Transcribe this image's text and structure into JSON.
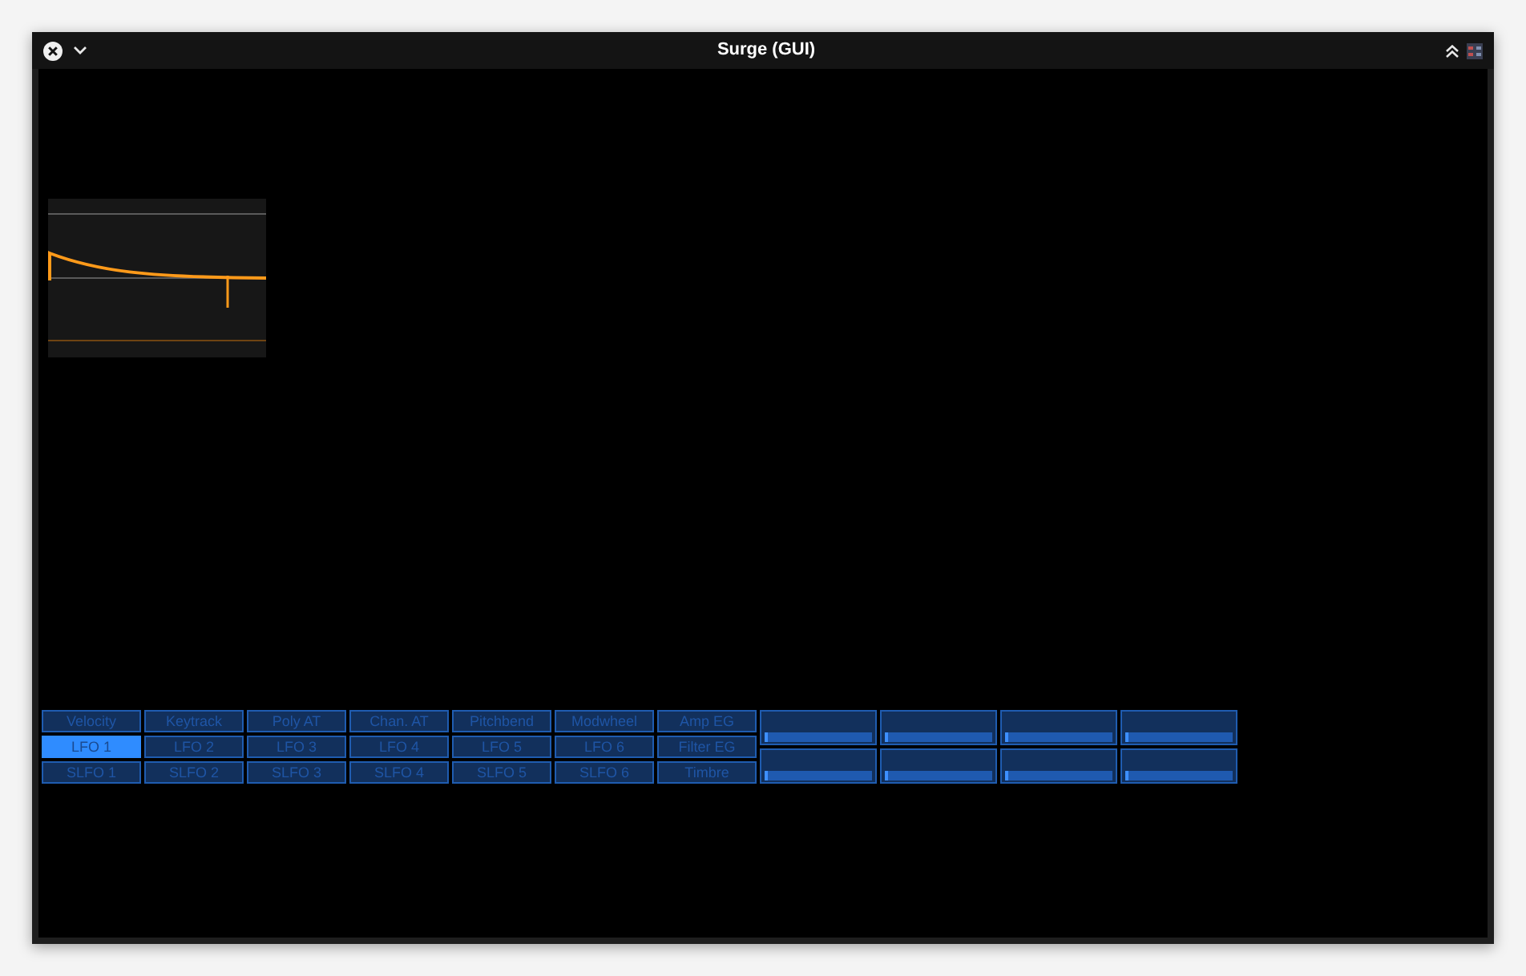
{
  "window": {
    "title": "Surge (GUI)"
  },
  "modulation_sources": [
    [
      {
        "label": "Velocity",
        "selected": false
      },
      {
        "label": "Keytrack",
        "selected": false
      },
      {
        "label": "Poly AT",
        "selected": false
      },
      {
        "label": "Chan. AT",
        "selected": false
      },
      {
        "label": "Pitchbend",
        "selected": false
      },
      {
        "label": "Modwheel",
        "selected": false
      },
      {
        "label": "Amp EG",
        "selected": false
      }
    ],
    [
      {
        "label": "LFO 1",
        "selected": true
      },
      {
        "label": "LFO 2",
        "selected": false
      },
      {
        "label": "LFO 3",
        "selected": false
      },
      {
        "label": "LFO 4",
        "selected": false
      },
      {
        "label": "LFO 5",
        "selected": false
      },
      {
        "label": "LFO 6",
        "selected": false
      },
      {
        "label": "Filter EG",
        "selected": false
      }
    ],
    [
      {
        "label": "SLFO 1",
        "selected": false
      },
      {
        "label": "SLFO 2",
        "selected": false
      },
      {
        "label": "SLFO 3",
        "selected": false
      },
      {
        "label": "SLFO 4",
        "selected": false
      },
      {
        "label": "SLFO 5",
        "selected": false
      },
      {
        "label": "SLFO 6",
        "selected": false
      },
      {
        "label": "Timbre",
        "selected": false
      }
    ]
  ],
  "macros": [
    {
      "level": 0
    },
    {
      "level": 0
    },
    {
      "level": 0
    },
    {
      "level": 0
    },
    {
      "level": 0
    },
    {
      "level": 0
    },
    {
      "level": 0
    },
    {
      "level": 0
    }
  ]
}
